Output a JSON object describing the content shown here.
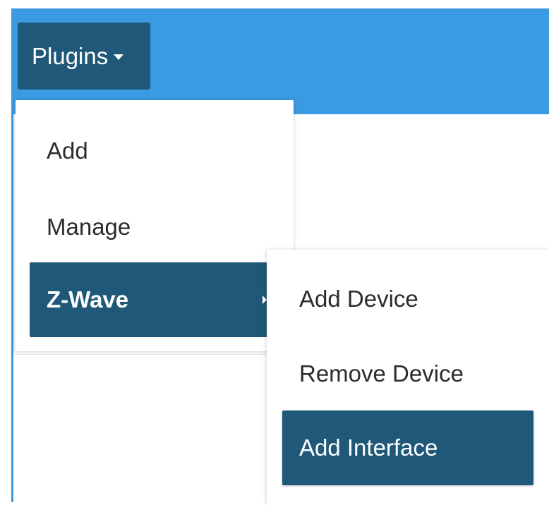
{
  "navbar": {
    "plugins_label": "Plugins",
    "plugins_caret": "caret-down-icon",
    "color": "#3a9ae2"
  },
  "menu": {
    "items": [
      {
        "label": "Add"
      },
      {
        "label": "Manage"
      },
      {
        "label": "Z-Wave",
        "active": true,
        "has_submenu": true
      }
    ],
    "active_color": "#1f5878"
  },
  "submenu": {
    "items": [
      {
        "label": "Add Device"
      },
      {
        "label": "Remove Device"
      },
      {
        "label": "Add Interface",
        "active": true
      }
    ]
  }
}
